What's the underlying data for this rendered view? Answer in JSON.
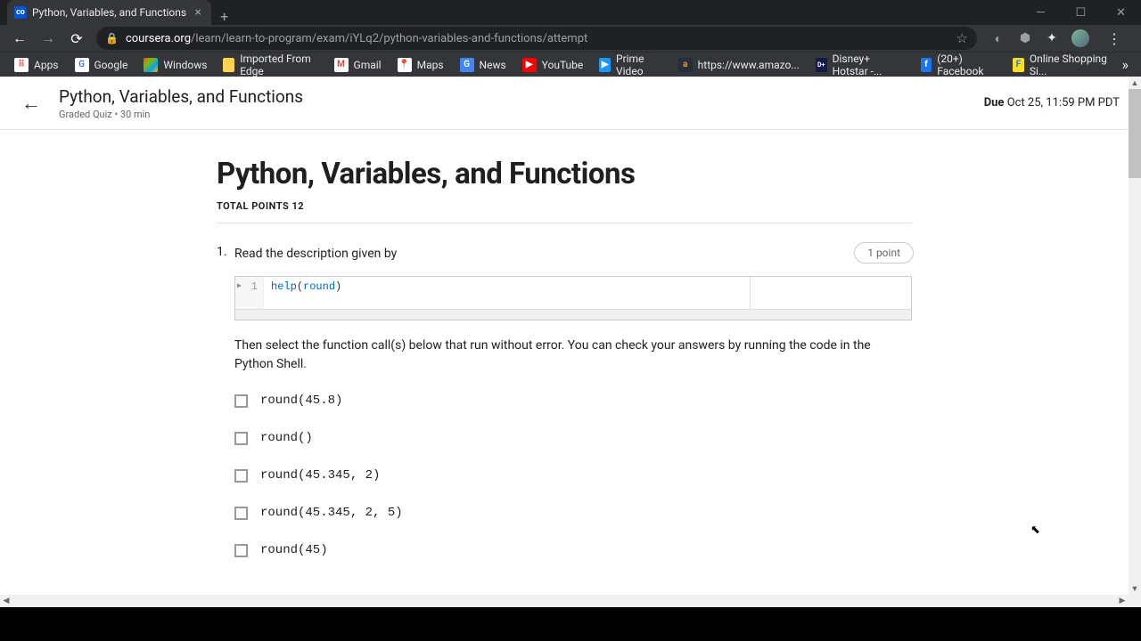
{
  "tab": {
    "title": "Python, Variables, and Functions",
    "favicon": "co"
  },
  "url": {
    "domain": "coursera.org",
    "path": "/learn/learn-to-program/exam/iYLq2/python-variables-and-functions/attempt"
  },
  "bookmarks": [
    {
      "label": "Apps",
      "icon_bg": "#fff",
      "icon_txt": "⠿",
      "icon_color": "#ea4335"
    },
    {
      "label": "Google",
      "icon_bg": "#fff",
      "icon_txt": "G",
      "icon_color": "#4285f4"
    },
    {
      "label": "Windows",
      "icon_bg": "#fff",
      "icon_txt": "⊞",
      "icon_color": "#00a4ef"
    },
    {
      "label": "Imported From Edge",
      "icon_bg": "#ffd54f",
      "icon_txt": "",
      "icon_color": "#333"
    },
    {
      "label": "Gmail",
      "icon_bg": "#fff",
      "icon_txt": "M",
      "icon_color": "#ea4335"
    },
    {
      "label": "Maps",
      "icon_bg": "#fff",
      "icon_txt": "📍",
      "icon_color": "#333"
    },
    {
      "label": "News",
      "icon_bg": "#4285f4",
      "icon_txt": "G",
      "icon_color": "#fff"
    },
    {
      "label": "YouTube",
      "icon_bg": "#fff",
      "icon_txt": "▶",
      "icon_color": "#ff0000"
    },
    {
      "label": "Prime Video",
      "icon_bg": "#1a98ff",
      "icon_txt": "▶",
      "icon_color": "#fff"
    },
    {
      "label": "https://www.amazo...",
      "icon_bg": "#232f3e",
      "icon_txt": "a",
      "icon_color": "#ff9900"
    },
    {
      "label": "Disney+ Hotstar -...",
      "icon_bg": "#0f1b4c",
      "icon_txt": "D+",
      "icon_color": "#fff"
    },
    {
      "label": "(20+) Facebook",
      "icon_bg": "#1877f2",
      "icon_txt": "f",
      "icon_color": "#fff"
    },
    {
      "label": "Online Shopping Si...",
      "icon_bg": "#ffe11b",
      "icon_txt": "F",
      "icon_color": "#2874f0"
    }
  ],
  "header": {
    "title": "Python, Variables, and Functions",
    "subtitle": "Graded Quiz • 30 min",
    "due_label": "Due",
    "due_value": "Oct 25, 11:59 PM PDT"
  },
  "quiz": {
    "title": "Python, Variables, and Functions",
    "total_points_label": "TOTAL POINTS 12"
  },
  "question1": {
    "number": "1.",
    "prompt": "Read the description given by",
    "points_badge": "1 point",
    "code_line_num": "1",
    "code_func": "help",
    "code_arg": "round",
    "followup": "Then select the function call(s) below that run without error. You can check your answers by running the code in the Python Shell.",
    "options": [
      "round(45.8)",
      "round()",
      "round(45.345, 2)",
      "round(45.345, 2, 5)",
      "round(45)"
    ]
  }
}
